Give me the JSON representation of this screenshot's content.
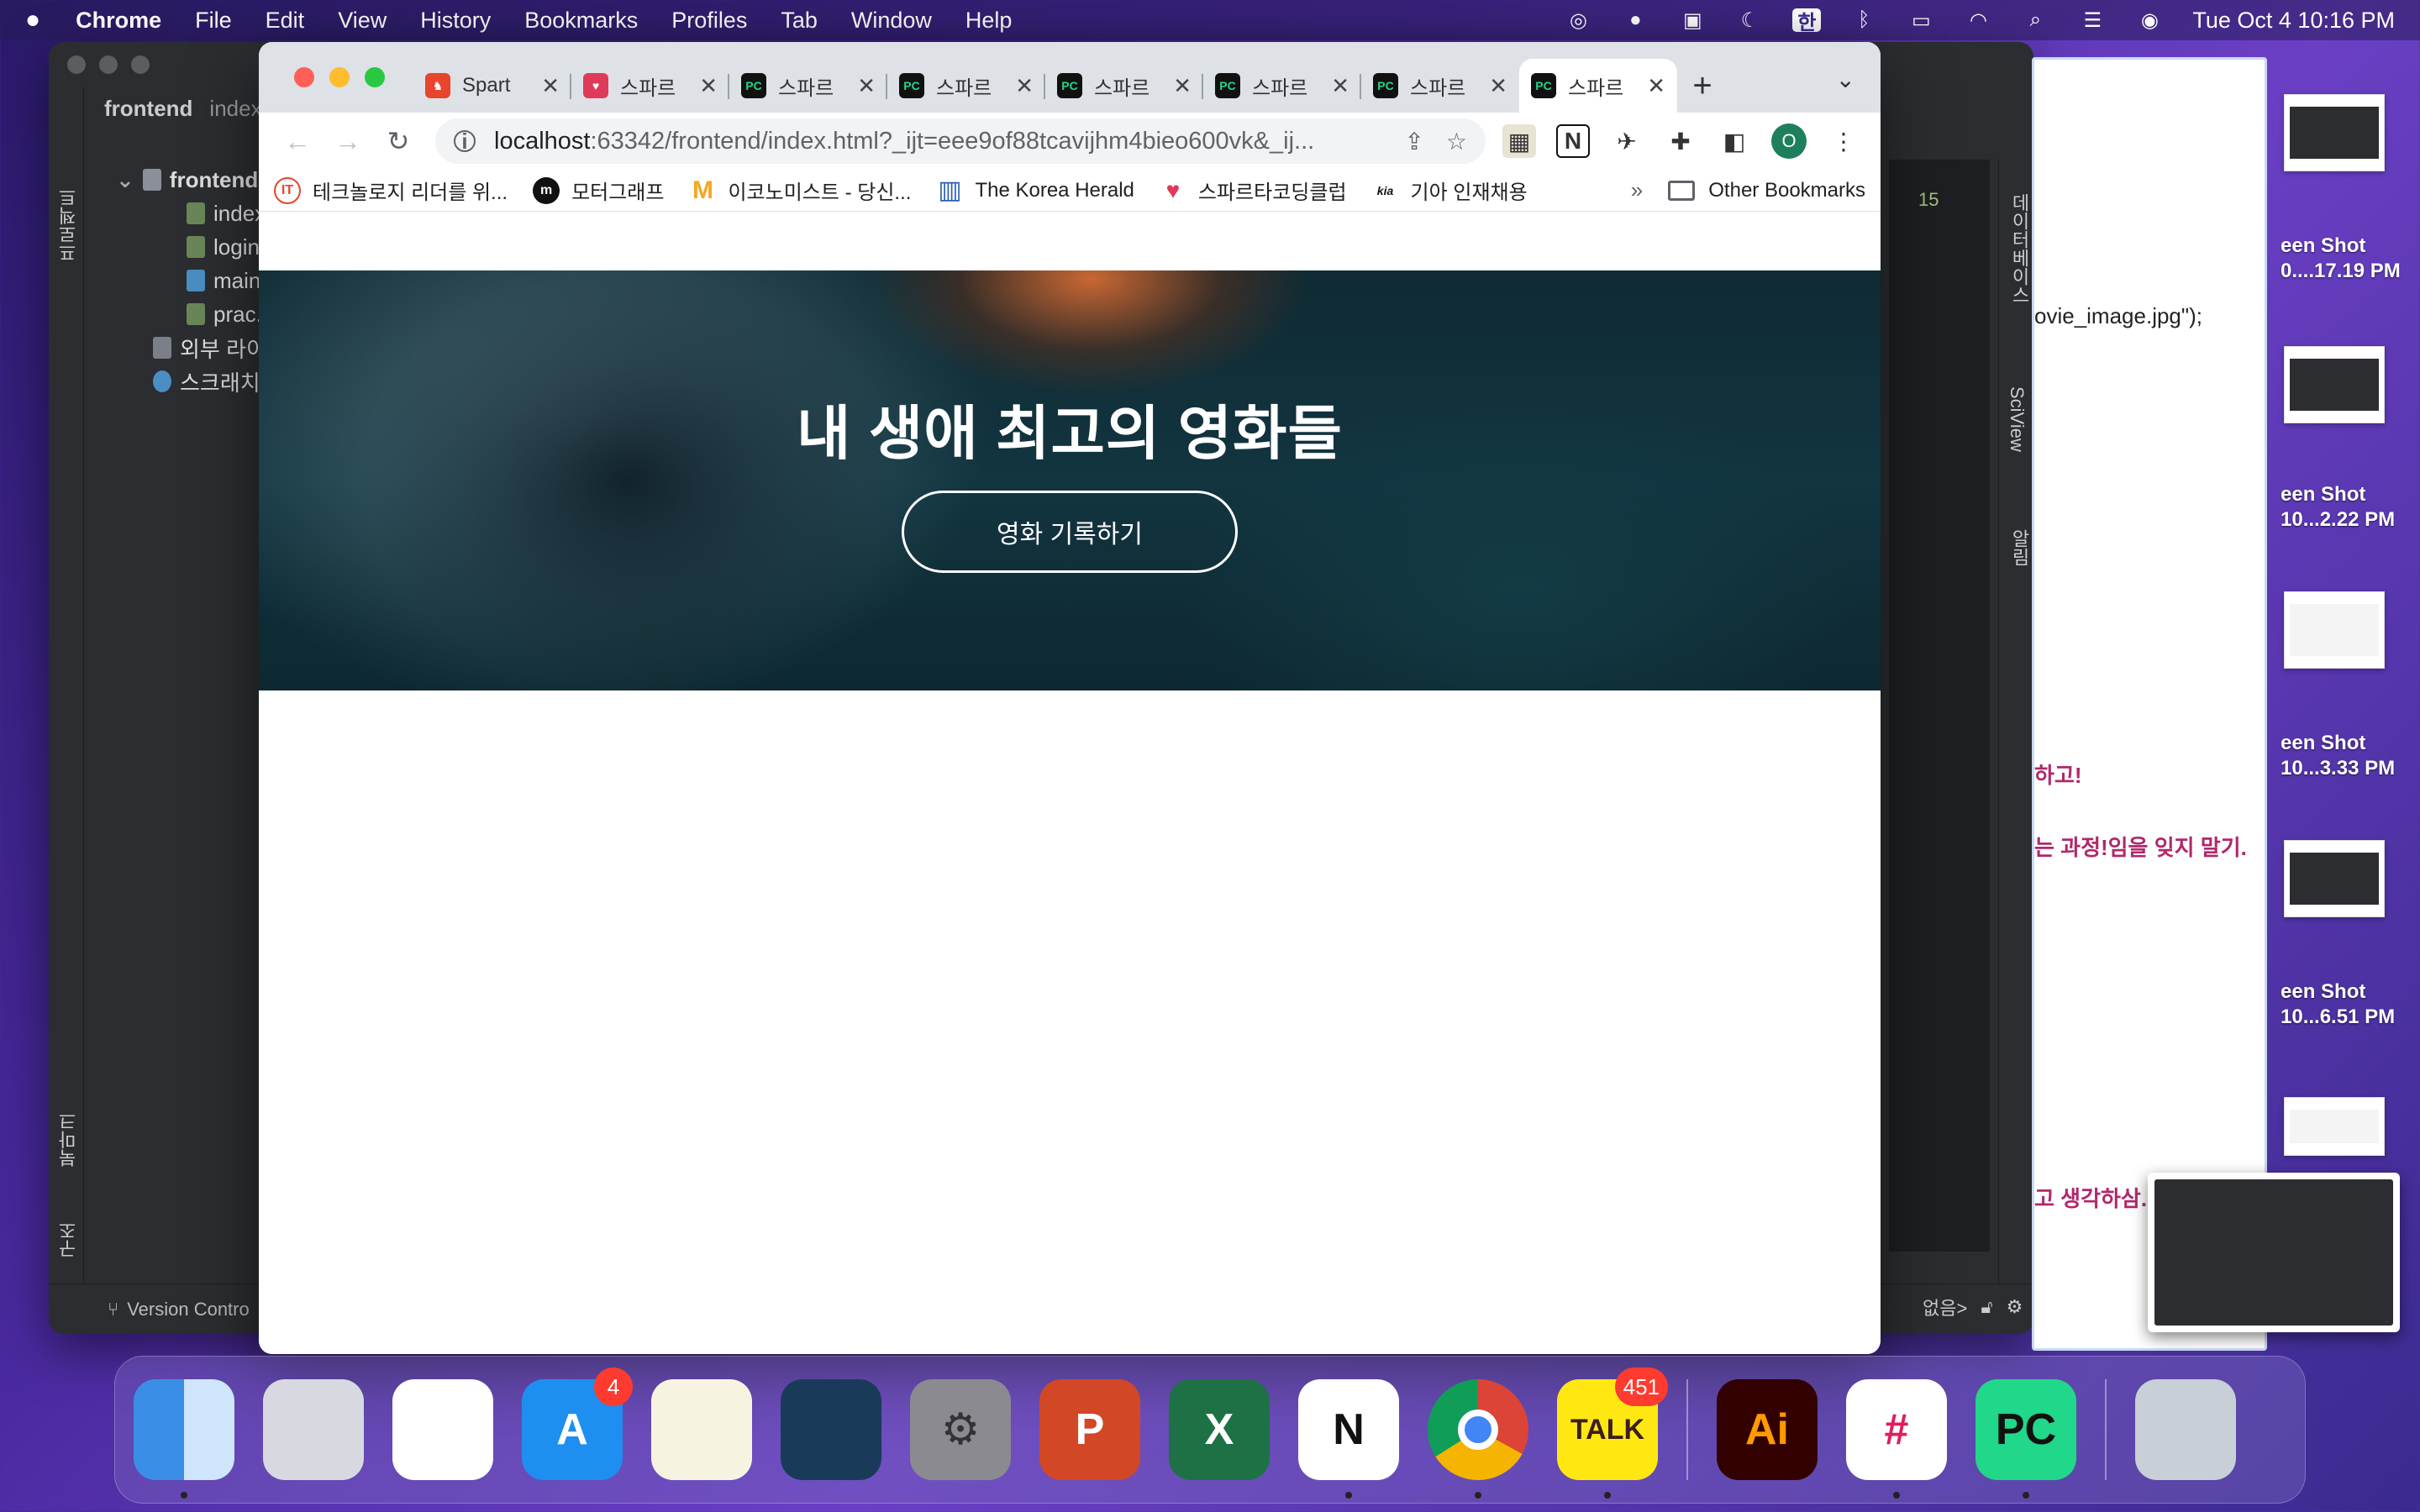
{
  "menubar": {
    "app_name": "Chrome",
    "items": [
      "File",
      "Edit",
      "View",
      "History",
      "Bookmarks",
      "Profiles",
      "Tab",
      "Window",
      "Help"
    ],
    "clock": "Tue Oct 4  10:16 PM",
    "input_method": "한"
  },
  "ide": {
    "project_label": "프로젝트",
    "project_name": "frontend",
    "tab_title": "index",
    "tree": [
      "frontend",
      "index.h",
      "login.ht",
      "main.py",
      "prac.ht",
      "외부 라이브",
      "스크래치 및"
    ],
    "right_labels": [
      "데이터베이스",
      "SciView",
      "알림"
    ],
    "left_bottom_labels": [
      "북마크",
      "구조"
    ],
    "version_control": "Version Contro",
    "warning_count": "15",
    "status_text": "없음>"
  },
  "doc": {
    "line1": "ovie_image.jpg\");",
    "line2": "하고!",
    "line3": "는 과정!임을 잊지 말기.",
    "line4": "고 생각하삼."
  },
  "desktop": {
    "labels": [
      "een Shot\n0....17.19 PM",
      "een Shot\n10...2.22 PM",
      "een Shot\n10...3.33 PM",
      "een Shot\n10...6.51 PM"
    ]
  },
  "chrome": {
    "tabs": [
      {
        "title": "Spart",
        "favicon_color": "#e8452c"
      },
      {
        "title": "스파르",
        "favicon_color": "#e03a5a"
      },
      {
        "title": "스파르",
        "favicon_color": "#21d789"
      },
      {
        "title": "스파르",
        "favicon_color": "#21d789"
      },
      {
        "title": "스파르",
        "favicon_color": "#21d789"
      },
      {
        "title": "스파르",
        "favicon_color": "#21d789"
      },
      {
        "title": "스파르",
        "favicon_color": "#21d789"
      },
      {
        "title": "스파르",
        "favicon_color": "#21d789",
        "active": true
      }
    ],
    "url_host": "localhost",
    "url_rest": ":63342/frontend/index.html?_ijt=eee9of88tcavijhm4bieo600vk&_ij...",
    "profile_initial": "O",
    "bookmarks": [
      {
        "label": "테크놀로지 리더를 위...",
        "icon": "IT",
        "color": "#e8452c"
      },
      {
        "label": "모터그래프",
        "icon": "m",
        "color": "#111"
      },
      {
        "label": "이코노미스트 - 당신...",
        "icon": "M",
        "color": "#f5a623"
      },
      {
        "label": "The Korea Herald",
        "icon": "▥",
        "color": "#2a5fb0"
      },
      {
        "label": "스파르타코딩클럽",
        "icon": "♥",
        "color": "#e03a5a"
      },
      {
        "label": "기아 인재채용",
        "icon": "kia",
        "color": "#111"
      }
    ],
    "bookmarks_more": "»",
    "other_bookmarks": "Other Bookmarks"
  },
  "page": {
    "hero_title": "내 생애 최고의 영화들",
    "hero_button": "영화 기록하기"
  },
  "dock": {
    "apps": [
      {
        "name": "Finder",
        "label": "",
        "bg": "#3a8ee6",
        "running": true
      },
      {
        "name": "Launchpad",
        "label": "",
        "bg": "#d8d8e0",
        "running": false
      },
      {
        "name": "Photos",
        "label": "",
        "bg": "#ffffff",
        "running": false
      },
      {
        "name": "App Store",
        "label": "A",
        "bg": "#1f8ef1",
        "badge": "4",
        "running": false
      },
      {
        "name": "Notes",
        "label": "",
        "bg": "#f7f3e1",
        "running": false
      },
      {
        "name": "Whale",
        "label": "",
        "bg": "#1a3a5a",
        "running": false
      },
      {
        "name": "System Preferences",
        "label": "⚙",
        "bg": "#8a8a90",
        "running": false
      },
      {
        "name": "PowerPoint",
        "label": "P",
        "bg": "#d24726",
        "running": false
      },
      {
        "name": "Excel",
        "label": "X",
        "bg": "#1e7145",
        "running": false
      },
      {
        "name": "Notion",
        "label": "N",
        "bg": "#ffffff",
        "running": true
      },
      {
        "name": "Chrome",
        "label": "",
        "bg": "#ffffff",
        "running": true
      },
      {
        "name": "KakaoTalk",
        "label": "TALK",
        "bg": "#ffe812",
        "badge": "451",
        "running": true
      },
      {
        "name": "Illustrator",
        "label": "Ai",
        "bg": "#330000",
        "running": false
      },
      {
        "name": "Slack",
        "label": "#",
        "bg": "#ffffff",
        "running": true
      },
      {
        "name": "PyCharm",
        "label": "PC",
        "bg": "#21d789",
        "running": true
      },
      {
        "name": "Trash",
        "label": "",
        "bg": "#c9cfd6",
        "running": false
      }
    ]
  }
}
